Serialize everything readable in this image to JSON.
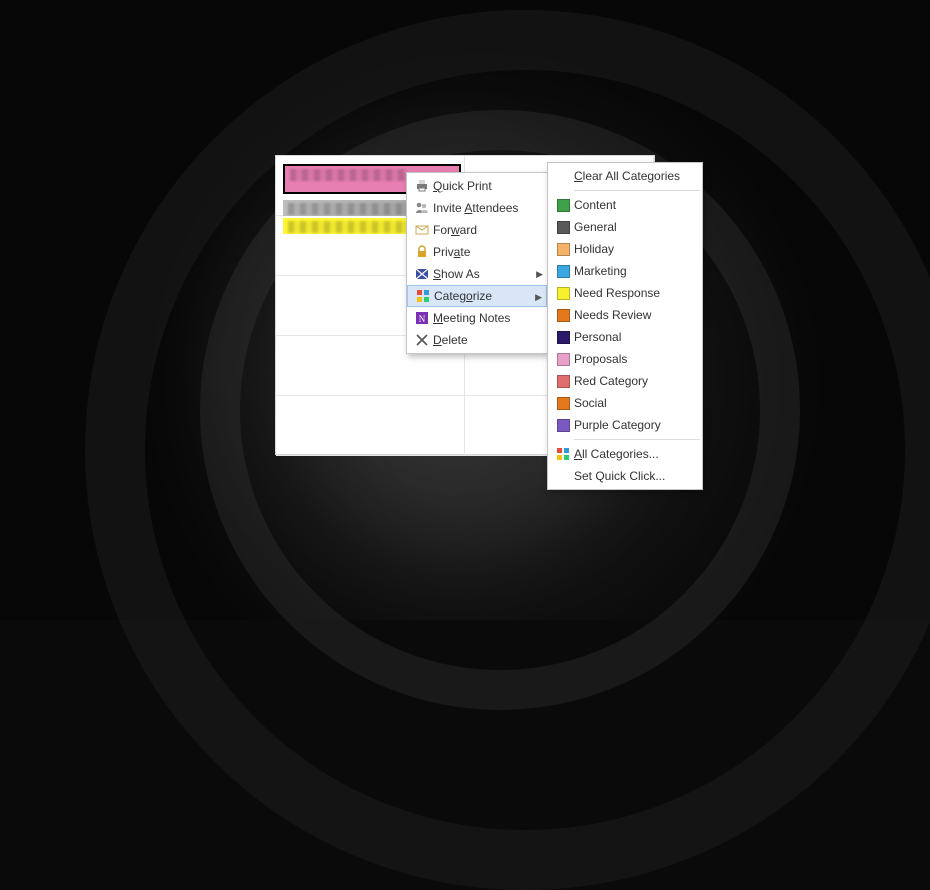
{
  "events": {
    "pink_tail": "ids"
  },
  "menu_a": {
    "quick_print": "Quick Print",
    "invite": "Invite Attendees",
    "forward": "Forward",
    "private": "Private",
    "show_as": "Show As",
    "categorize": "Categorize",
    "meeting_notes": "Meeting Notes",
    "delete": "Delete"
  },
  "menu_b": {
    "clear": "Clear All Categories",
    "all_categories": "All Categories...",
    "set_quick": "Set Quick Click...",
    "items": [
      {
        "label": "Content",
        "color": "#3fa24a"
      },
      {
        "label": "General",
        "color": "#595959"
      },
      {
        "label": "Holiday",
        "color": "#f2b267"
      },
      {
        "label": "Marketing",
        "color": "#3ba7e0"
      },
      {
        "label": "Need Response",
        "color": "#f7f12d"
      },
      {
        "label": "Needs Review",
        "color": "#e27a1d"
      },
      {
        "label": "Personal",
        "color": "#2b1a6a"
      },
      {
        "label": "Proposals",
        "color": "#e7a0c7"
      },
      {
        "label": "Red Category",
        "color": "#e06e6e"
      },
      {
        "label": "Social",
        "color": "#e27a1d"
      },
      {
        "label": "Purple Category",
        "color": "#7b5bc2"
      }
    ]
  }
}
